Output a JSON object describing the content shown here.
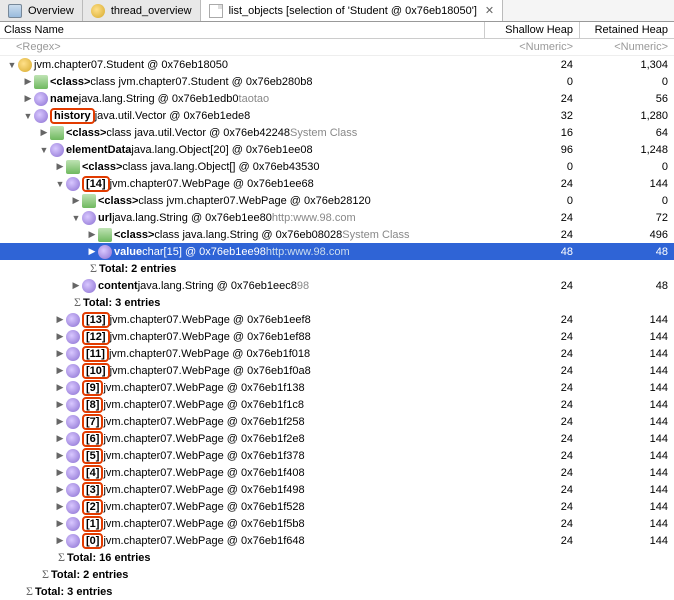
{
  "tabs": [
    {
      "icon": "info",
      "label": "Overview"
    },
    {
      "icon": "thread",
      "label": "thread_overview"
    },
    {
      "icon": "list",
      "label": "list_objects  [selection of 'Student @ 0x76eb18050']",
      "active": true
    }
  ],
  "columns": {
    "name": "Class Name",
    "shallow": "Shallow Heap",
    "retained": "Retained Heap"
  },
  "filters": {
    "name": "<Regex>",
    "shallow": "<Numeric>",
    "retained": "<Numeric>"
  },
  "rows": [
    {
      "depth": 0,
      "arrow": "down",
      "icon": "obj",
      "text": "jvm.chapter07.Student @ 0x76eb18050",
      "shallow": "24",
      "retained": "1,304"
    },
    {
      "depth": 1,
      "arrow": "right",
      "icon": "class",
      "bold": "<class>",
      "rest": " class jvm.chapter07.Student @ 0x76eb280b8",
      "shallow": "0",
      "retained": "0"
    },
    {
      "depth": 1,
      "arrow": "right",
      "icon": "field",
      "bold": "name",
      "rest": " java.lang.String @ 0x76eb1edb0  ",
      "dim": "taotao",
      "shallow": "24",
      "retained": "56"
    },
    {
      "depth": 1,
      "arrow": "down",
      "icon": "field",
      "redbox": "history",
      "rest": " java.util.Vector @ 0x76eb1ede8",
      "shallow": "32",
      "retained": "1,280"
    },
    {
      "depth": 2,
      "arrow": "right",
      "icon": "class",
      "bold": "<class>",
      "rest": " class java.util.Vector @ 0x76eb42248  ",
      "dim": "System Class",
      "shallow": "16",
      "retained": "64"
    },
    {
      "depth": 2,
      "arrow": "down",
      "icon": "field",
      "bold": "elementData",
      "rest": " java.lang.Object[20] @ 0x76eb1ee08",
      "shallow": "96",
      "retained": "1,248"
    },
    {
      "depth": 3,
      "arrow": "right",
      "icon": "class",
      "bold": "<class>",
      "rest": " class java.lang.Object[] @ 0x76eb43530",
      "shallow": "0",
      "retained": "0"
    },
    {
      "depth": 3,
      "arrow": "down",
      "icon": "field",
      "redbox": "[14]",
      "rest": " jvm.chapter07.WebPage @ 0x76eb1ee68",
      "shallow": "24",
      "retained": "144"
    },
    {
      "depth": 4,
      "arrow": "right",
      "icon": "class",
      "bold": "<class>",
      "rest": " class jvm.chapter07.WebPage @ 0x76eb28120",
      "shallow": "0",
      "retained": "0"
    },
    {
      "depth": 4,
      "arrow": "down",
      "icon": "field",
      "bold": "url",
      "rest": " java.lang.String @ 0x76eb1ee80  ",
      "dim": "http:www.98.com",
      "shallow": "24",
      "retained": "72"
    },
    {
      "depth": 5,
      "arrow": "right",
      "icon": "class",
      "bold": "<class>",
      "rest": " class java.lang.String @ 0x76eb08028  ",
      "dim": "System Class",
      "shallow": "24",
      "retained": "496"
    },
    {
      "depth": 5,
      "arrow": "right",
      "icon": "field",
      "bold": "value",
      "rest": " char[15] @ 0x76eb1ee98  ",
      "dim": "http:www.98.com",
      "shallow": "48",
      "retained": "48",
      "selected": true
    },
    {
      "depth": 5,
      "sigma": true,
      "text": "Total: 2 entries",
      "shallow": "",
      "retained": ""
    },
    {
      "depth": 4,
      "arrow": "right",
      "icon": "field",
      "bold": "content",
      "rest": " java.lang.String @ 0x76eb1eec8  ",
      "dim": "98",
      "shallow": "24",
      "retained": "48"
    },
    {
      "depth": 4,
      "sigma": true,
      "text": "Total: 3 entries",
      "shallow": "",
      "retained": ""
    },
    {
      "depth": 3,
      "arrow": "right",
      "icon": "field",
      "redbox": "[13]",
      "rest": " jvm.chapter07.WebPage @ 0x76eb1eef8",
      "shallow": "24",
      "retained": "144",
      "vstart": true
    },
    {
      "depth": 3,
      "arrow": "right",
      "icon": "field",
      "redbox": "[12]",
      "rest": " jvm.chapter07.WebPage @ 0x76eb1ef88",
      "shallow": "24",
      "retained": "144"
    },
    {
      "depth": 3,
      "arrow": "right",
      "icon": "field",
      "redbox": "[11]",
      "rest": " jvm.chapter07.WebPage @ 0x76eb1f018",
      "shallow": "24",
      "retained": "144"
    },
    {
      "depth": 3,
      "arrow": "right",
      "icon": "field",
      "redbox": "[10]",
      "rest": " jvm.chapter07.WebPage @ 0x76eb1f0a8",
      "shallow": "24",
      "retained": "144"
    },
    {
      "depth": 3,
      "arrow": "right",
      "icon": "field",
      "redbox": "[9]",
      "rest": " jvm.chapter07.WebPage @ 0x76eb1f138",
      "shallow": "24",
      "retained": "144"
    },
    {
      "depth": 3,
      "arrow": "right",
      "icon": "field",
      "redbox": "[8]",
      "rest": " jvm.chapter07.WebPage @ 0x76eb1f1c8",
      "shallow": "24",
      "retained": "144"
    },
    {
      "depth": 3,
      "arrow": "right",
      "icon": "field",
      "redbox": "[7]",
      "rest": " jvm.chapter07.WebPage @ 0x76eb1f258",
      "shallow": "24",
      "retained": "144"
    },
    {
      "depth": 3,
      "arrow": "right",
      "icon": "field",
      "redbox": "[6]",
      "rest": " jvm.chapter07.WebPage @ 0x76eb1f2e8",
      "shallow": "24",
      "retained": "144"
    },
    {
      "depth": 3,
      "arrow": "right",
      "icon": "field",
      "redbox": "[5]",
      "rest": " jvm.chapter07.WebPage @ 0x76eb1f378",
      "shallow": "24",
      "retained": "144"
    },
    {
      "depth": 3,
      "arrow": "right",
      "icon": "field",
      "redbox": "[4]",
      "rest": " jvm.chapter07.WebPage @ 0x76eb1f408",
      "shallow": "24",
      "retained": "144"
    },
    {
      "depth": 3,
      "arrow": "right",
      "icon": "field",
      "redbox": "[3]",
      "rest": " jvm.chapter07.WebPage @ 0x76eb1f498",
      "shallow": "24",
      "retained": "144"
    },
    {
      "depth": 3,
      "arrow": "right",
      "icon": "field",
      "redbox": "[2]",
      "rest": " jvm.chapter07.WebPage @ 0x76eb1f528",
      "shallow": "24",
      "retained": "144"
    },
    {
      "depth": 3,
      "arrow": "right",
      "icon": "field",
      "redbox": "[1]",
      "rest": " jvm.chapter07.WebPage @ 0x76eb1f5b8",
      "shallow": "24",
      "retained": "144"
    },
    {
      "depth": 3,
      "arrow": "right",
      "icon": "field",
      "redbox": "[0]",
      "rest": " jvm.chapter07.WebPage @ 0x76eb1f648",
      "shallow": "24",
      "retained": "144",
      "vend": true
    },
    {
      "depth": 3,
      "sigma": true,
      "text": "Total: 16 entries",
      "shallow": "",
      "retained": ""
    },
    {
      "depth": 2,
      "sigma": true,
      "text": "Total: 2 entries",
      "shallow": "",
      "retained": ""
    },
    {
      "depth": 1,
      "sigma": true,
      "text": "Total: 3 entries",
      "shallow": "",
      "retained": ""
    }
  ]
}
